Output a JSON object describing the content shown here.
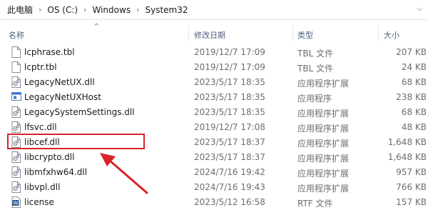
{
  "address_bar": {
    "crumbs": [
      "此电脑",
      "OS (C:)",
      "Windows",
      "System32"
    ],
    "separator": "›"
  },
  "columns": {
    "name": "名称",
    "date": "修改日期",
    "type": "类型",
    "size": "大小"
  },
  "files": [
    {
      "name": "lcphrase.tbl",
      "date": "2019/12/7 17:09",
      "type": "TBL 文件",
      "size": "207 KB",
      "icon": "generic-file-icon"
    },
    {
      "name": "lcptr.tbl",
      "date": "2019/12/7 17:09",
      "type": "TBL 文件",
      "size": "24 KB",
      "icon": "generic-file-icon"
    },
    {
      "name": "LegacyNetUX.dll",
      "date": "2023/5/17 18:35",
      "type": "应用程序扩展",
      "size": "68 KB",
      "icon": "dll-file-icon"
    },
    {
      "name": "LegacyNetUXHost",
      "date": "2023/5/17 18:35",
      "type": "应用程序",
      "size": "238 KB",
      "icon": "application-icon"
    },
    {
      "name": "LegacySystemSettings.dll",
      "date": "2023/5/17 18:35",
      "type": "应用程序扩展",
      "size": "68 KB",
      "icon": "dll-file-icon"
    },
    {
      "name": "lfsvc.dll",
      "date": "2019/12/7 17:08",
      "type": "应用程序扩展",
      "size": "48 KB",
      "icon": "dll-file-icon"
    },
    {
      "name": "libcef.dll",
      "date": "2023/5/17 18:37",
      "type": "应用程序扩展",
      "size": "1,648 KB",
      "icon": "dll-file-icon"
    },
    {
      "name": "libcrypto.dll",
      "date": "2023/5/17 18:37",
      "type": "应用程序扩展",
      "size": "1,648 KB",
      "icon": "dll-file-icon"
    },
    {
      "name": "libmfxhw64.dll",
      "date": "2024/7/16 19:42",
      "type": "应用程序扩展",
      "size": "957 KB",
      "icon": "dll-file-icon"
    },
    {
      "name": "libvpl.dll",
      "date": "2024/7/16 19:43",
      "type": "应用程序扩展",
      "size": "766 KB",
      "icon": "dll-file-icon"
    },
    {
      "name": "license",
      "date": "2023/5/12 16:58",
      "type": "RTF 文件",
      "size": "157 KB",
      "icon": "rtf-file-icon"
    }
  ],
  "annotation": {
    "highlighted_file": "libcef.dll",
    "color": "#d9232a"
  }
}
